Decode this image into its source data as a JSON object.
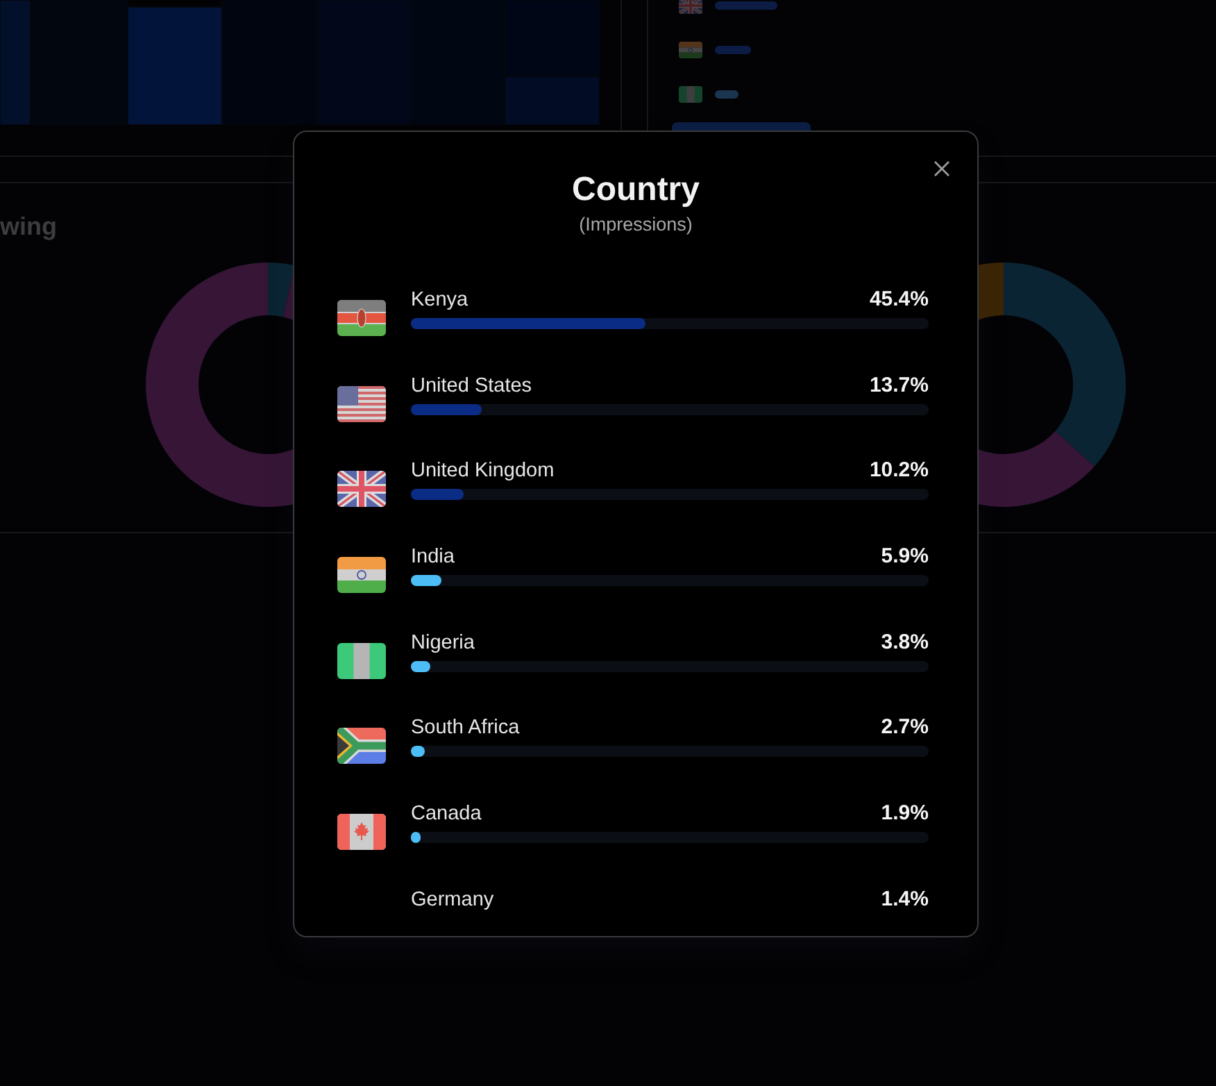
{
  "background": {
    "country_preview": [
      {
        "kind": "gb"
      },
      {
        "kind": "in"
      },
      {
        "kind": "ng"
      }
    ],
    "card": {
      "heading": "wing"
    }
  },
  "modal": {
    "title": "Country",
    "subtitle": "(Impressions)",
    "countries": [
      {
        "kind": "ke",
        "name": "Kenya",
        "share": "45.4%",
        "level": 0.454,
        "color": "#0b2c85"
      },
      {
        "kind": "us",
        "name": "United States",
        "share": "13.7%",
        "level": 0.137,
        "color": "#0b2c85"
      },
      {
        "kind": "gb",
        "name": "United Kingdom",
        "share": "10.2%",
        "level": 0.102,
        "color": "#0b2c85"
      },
      {
        "kind": "in",
        "name": "India",
        "share": "5.9%",
        "level": 0.059,
        "color": "#4dbdf5"
      },
      {
        "kind": "ng",
        "name": "Nigeria",
        "share": "3.8%",
        "level": 0.038,
        "color": "#4dbdf5"
      },
      {
        "kind": "za",
        "name": "South Africa",
        "share": "2.7%",
        "level": 0.027,
        "color": "#4dbdf5"
      },
      {
        "kind": "ca",
        "name": "Canada",
        "share": "1.9%",
        "level": 0.019,
        "color": "#4dbdf5"
      },
      {
        "name": "Germany",
        "share": "1.4%"
      }
    ]
  }
}
